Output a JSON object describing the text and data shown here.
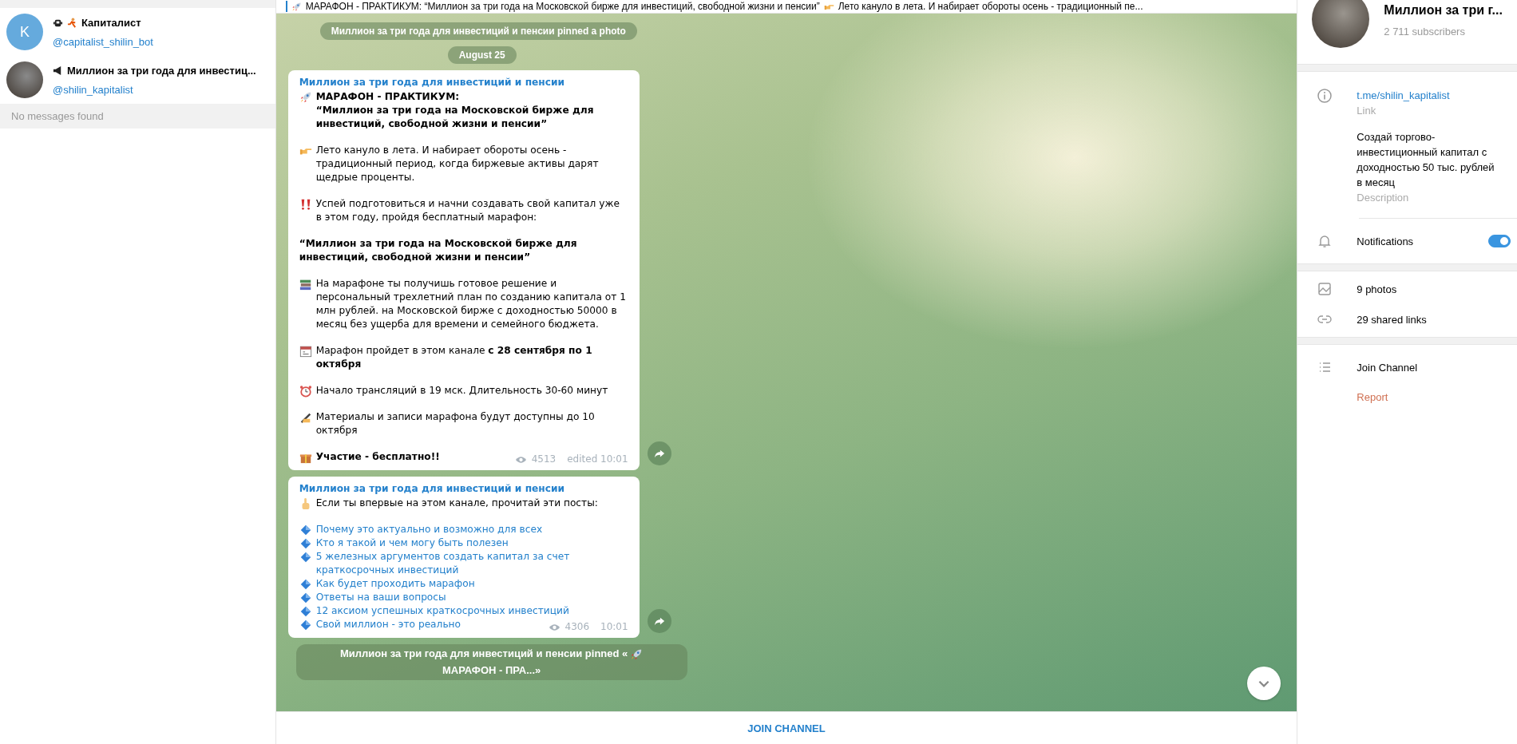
{
  "search_results": [
    {
      "title": "Капиталист",
      "username": "@capitalist_shilin_bot",
      "avatar_letter": "K",
      "kind": "bot"
    },
    {
      "title": "Миллион за три года для инвестиц...",
      "username": "@shilin_kapitalist",
      "kind": "channel"
    }
  ],
  "search_status": "No messages found",
  "pinned_bar": {
    "text": "МАРАФОН - ПРАКТИКУМ: “Миллион за три года на Московской бирже для инвестиций, свободной жизни и пенсии”",
    "text_2": "Лето кануло в лета. И набирает обороты осень - традиционный  пе..."
  },
  "service_top": "Миллион за три года для инвестиций и пенсии pinned a photo",
  "date": "August 25",
  "messages": [
    {
      "author": "Миллион за три года для инвестиций и пенсии",
      "views": "4513",
      "time": "edited 10:01",
      "paragraphs": [
        {
          "kind": "bold",
          "text": "МАРАФОН - ПРАКТИКУМ:\n“Миллион за три года на Московской бирже для инвестиций, свободной жизни и пенсии”"
        },
        {
          "kind": "plain",
          "text": "Лето кануло в лета. И набирает обороты осень - традиционный  период, когда биржевые активы дарят щедрые проценты."
        },
        {
          "kind": "plain",
          "text": "Успей подготовиться и начни создавать свой капитал уже в этом году, пройдя бесплатный марафон:"
        },
        {
          "kind": "bold",
          "text": "“Миллион за три года на Московской бирже для инвестиций, свободной жизни и пенсии”"
        },
        {
          "kind": "plain",
          "text": "На марафоне ты получишь готовое решение и персональный трехлетний план по созданию капитала от 1 млн рублей. на Московской бирже с доходностью 50000  в месяц без ущерба для времени и семейного бюджета."
        },
        {
          "kind": "plain",
          "text": "Марафон пройдет в этом канале **с 28 сентября по 1 октября**"
        },
        {
          "kind": "plain",
          "text": "Начало трансляций в 19 мск. Длительность 30-60 минут"
        },
        {
          "kind": "plain",
          "text": "Материалы и записи марафона будут доступны до 10 октября"
        },
        {
          "kind": "bold",
          "text": "Участие - бесплатно!!"
        }
      ]
    },
    {
      "author": "Миллион за три года для инвестиций и пенсии",
      "views": "4306",
      "time": "10:01",
      "paragraphs": [
        {
          "kind": "plain",
          "text": "Если ты впервые на этом канале, прочитай эти посты:"
        }
      ],
      "links": [
        "Почему это актуально и возможно для всех",
        "Кто я такой и чем могу быть полезен",
        "5 железных аргументов создать капитал за счет краткосрочных инвестиций",
        "Как будет проходить марафон",
        "Ответы на ваши вопросы",
        "12 аксиом успешных краткосрочных инвестиций",
        "Свой миллион - это реально"
      ]
    }
  ],
  "service_bottom": {
    "text": "Миллион за три года для инвестиций и пенсии pinned «",
    "text_2": "МАРАФОН - ПРА...»"
  },
  "join_button": "JOIN CHANNEL",
  "profile": {
    "title": "Миллион за три г...",
    "subscribers": "2 711 subscribers",
    "link": "t.me/shilin_kapitalist",
    "link_label": "Link",
    "description": "Создай торгово-инвестиционный капитал с доходностью 50 тыс. рублей в месяц",
    "description_label": "Description",
    "notifications": {
      "label": "Notifications",
      "on": true
    },
    "media": [
      "9 photos",
      "29 shared links"
    ],
    "join": "Join Channel",
    "report": "Report"
  }
}
